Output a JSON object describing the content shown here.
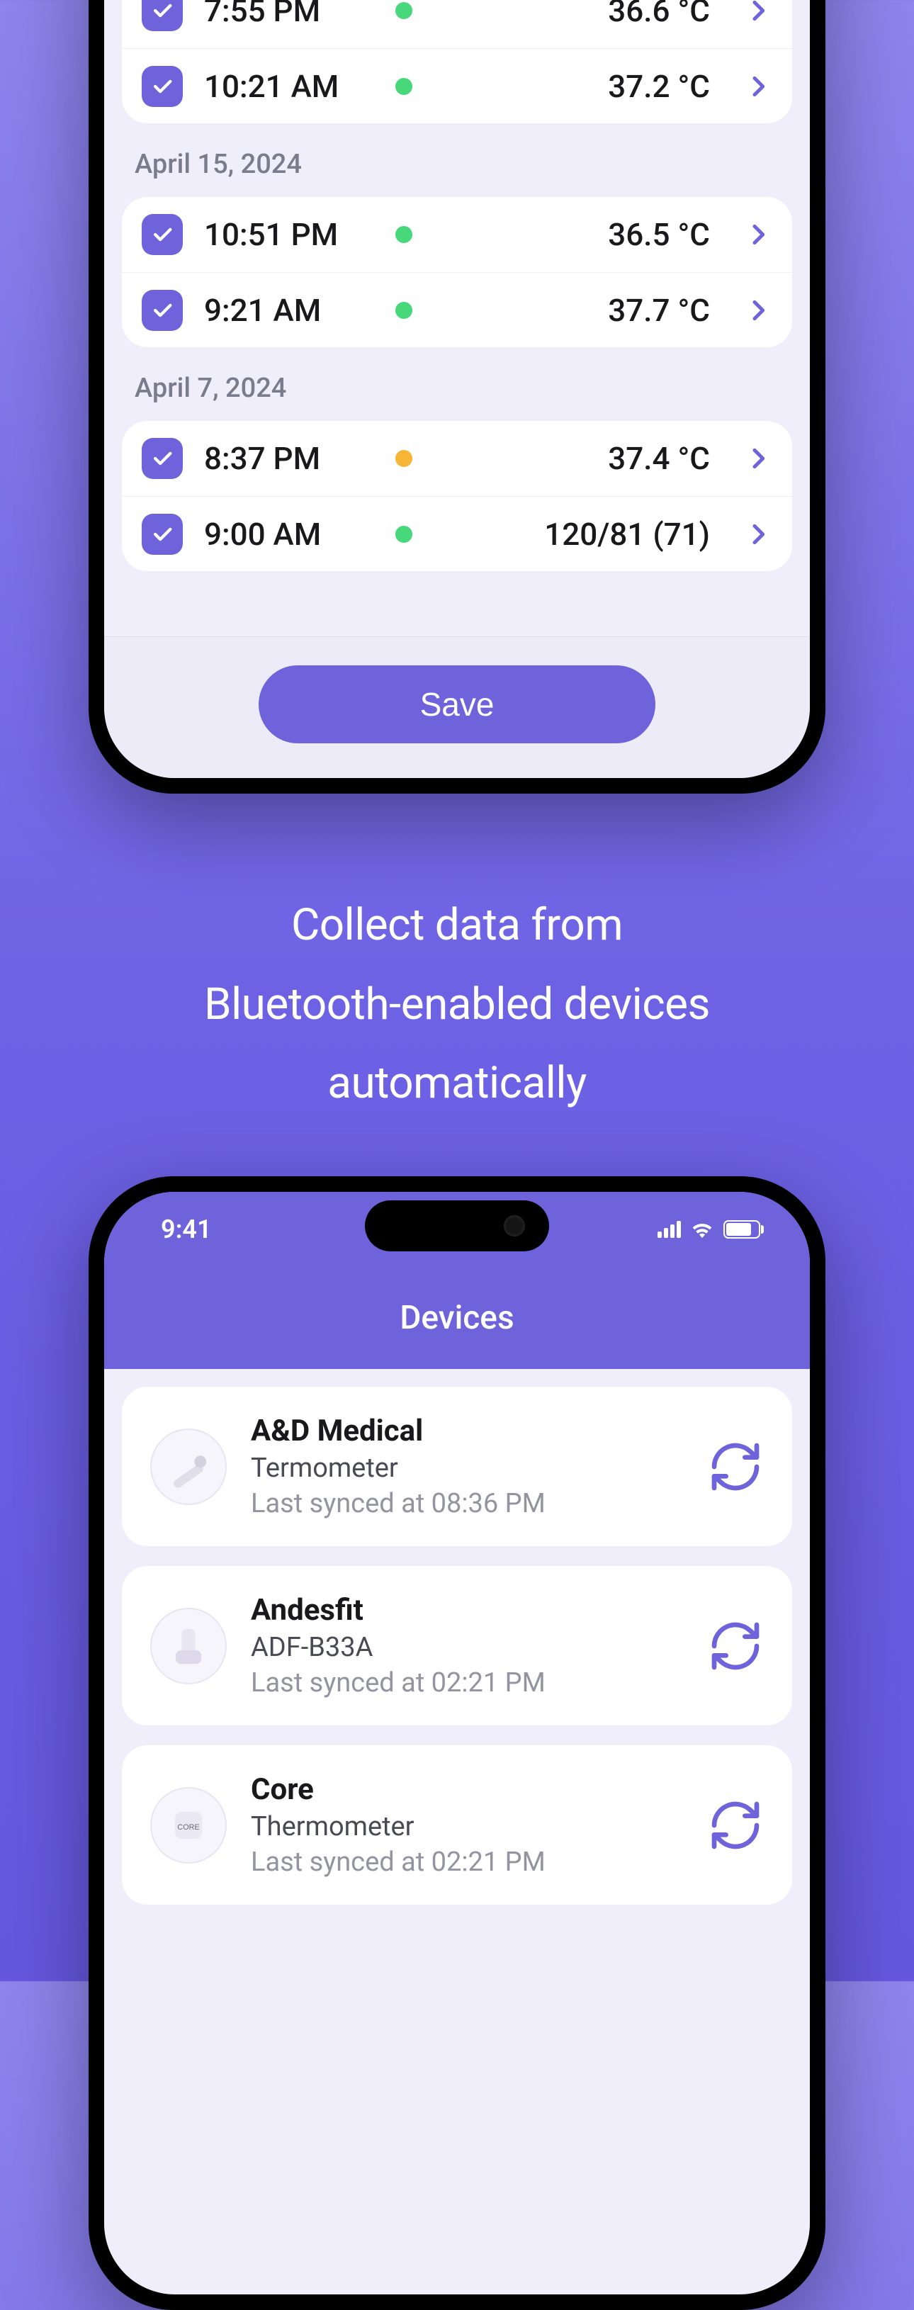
{
  "top": {
    "sections": [
      {
        "date": "",
        "rows": [
          {
            "time": "7:55 PM",
            "dot": "green",
            "value": "36.6 °C"
          },
          {
            "time": "10:21 AM",
            "dot": "green",
            "value": "37.2 °C"
          }
        ]
      },
      {
        "date": "April 15, 2024",
        "rows": [
          {
            "time": "10:51 PM",
            "dot": "green",
            "value": "36.5 °C"
          },
          {
            "time": "9:21 AM",
            "dot": "green",
            "value": "37.7 °C"
          }
        ]
      },
      {
        "date": "April 7, 2024",
        "rows": [
          {
            "time": "8:37 PM",
            "dot": "amber",
            "value": "37.4 °C"
          },
          {
            "time": "9:00 AM",
            "dot": "green",
            "value": "120/81 (71)"
          }
        ]
      }
    ],
    "save_label": "Save"
  },
  "marketing": {
    "line1": "Collect data from",
    "line2": "Bluetooth-enabled devices",
    "line3": "automatically"
  },
  "bottom": {
    "status_time": "9:41",
    "header_title": "Devices",
    "devices": [
      {
        "name": "A&D Medical",
        "model": "Termometer",
        "sync": "Last synced at 08:36 PM"
      },
      {
        "name": "Andesfit",
        "model": "ADF-B33A",
        "sync": "Last synced at 02:21 PM"
      },
      {
        "name": "Core",
        "model": "Thermometer",
        "sync": "Last synced at 02:21 PM"
      }
    ]
  }
}
